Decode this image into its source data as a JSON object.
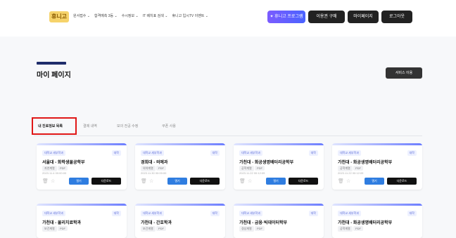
{
  "header": {
    "logo": "휴니고",
    "nav": [
      "원서접수 ⌄",
      "합격예측 3등 ⌄",
      "수시정보 ⌄",
      "IT 배치표 검색 ⌄",
      "휴니고 입시TV 이벤트 ⌄"
    ],
    "buttons": [
      "✦ 휴니고 프로그램",
      "이용권 구매",
      "마이페이지",
      "로그아웃"
    ]
  },
  "page": {
    "title": "마이 페이지",
    "service_button": "서비스 이용"
  },
  "tabs": [
    "내 진로정보 목록",
    "결제 내역",
    "모의 전공 수정",
    "쿠폰 사용"
  ],
  "cards": [
    {
      "badge": "대학교 세부학과",
      "tag": "대학",
      "title": "서울대 - 화학생물공학부",
      "chips": [
        "자연계열",
        "PDF"
      ],
      "meta": "2023.11.4 00:00:00",
      "btn_blue": "열기",
      "btn_dark": "다운로드"
    },
    {
      "badge": "대학교 세부학과",
      "tag": "대학",
      "title": "경희대 - 의예과",
      "chips": [
        "의약계열",
        "PDF"
      ],
      "meta": "2023.11.30 00:00:00",
      "btn_blue": "열기",
      "btn_dark": "다운로드"
    },
    {
      "badge": "대학교 세부학과",
      "tag": "대학",
      "title": "가천대 - 화공생명배터리공학부",
      "chips": [
        "공학계열",
        "PDF"
      ],
      "meta": "2023.11.22 00:12:09",
      "btn_blue": "열기",
      "btn_dark": "다운로드"
    },
    {
      "badge": "대학교 세부학과",
      "tag": "대학",
      "title": "가천대 - 화공생명배터리공학부",
      "chips": [
        "공학계열",
        "PDF"
      ],
      "meta": "2023.11.22 00:12:09",
      "btn_blue": "열기",
      "btn_dark": "다운로드"
    },
    {
      "badge": "대학교 세부학과",
      "tag": "대학",
      "title": "가천대 - 물리치료학과",
      "chips": [
        "보건계열",
        "PDF"
      ],
      "meta": "",
      "btn_blue": "",
      "btn_dark": ""
    },
    {
      "badge": "대학교 세부학과",
      "tag": "대학",
      "title": "가천대 - 간호학과",
      "chips": [
        "보건계열",
        "PDF"
      ],
      "meta": "",
      "btn_blue": "",
      "btn_dark": ""
    },
    {
      "badge": "대학교 세부학과",
      "tag": "대학",
      "title": "가천대 - 금융·빅데이터학부",
      "chips": [
        "경상계열",
        "PDF"
      ],
      "meta": "",
      "btn_blue": "",
      "btn_dark": ""
    },
    {
      "badge": "대학교 세부학과",
      "tag": "대학",
      "title": "가천대 - 화공생명배터리공학부",
      "chips": [
        "공학계열",
        "PDF"
      ],
      "meta": "",
      "btn_blue": "",
      "btn_dark": ""
    }
  ],
  "colors": {
    "accent": "#2f7de0",
    "highlight": "#e01717",
    "title_bar": "#1f2d6b",
    "primary_gradient": "#7b5cff"
  }
}
